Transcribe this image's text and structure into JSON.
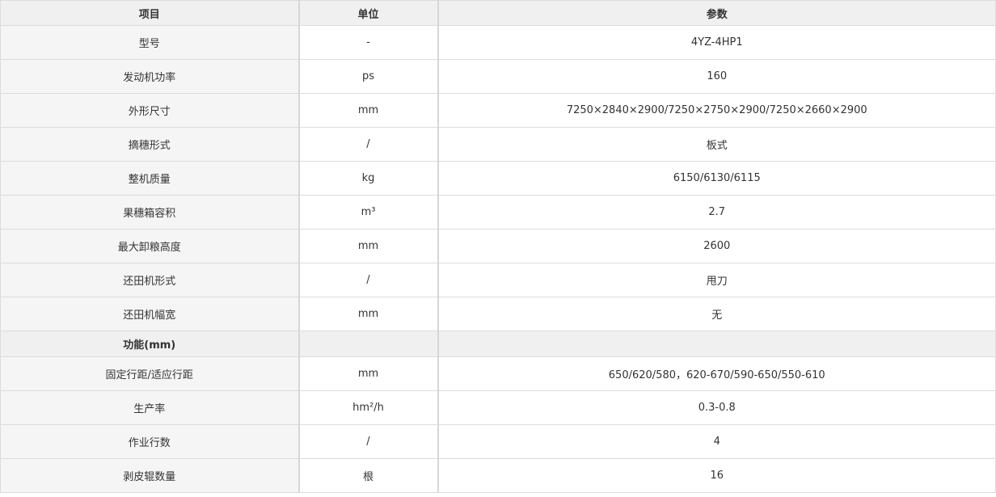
{
  "table": {
    "headers": [
      "项目",
      "单位",
      "参数"
    ],
    "rows": [
      {
        "item": "型号",
        "unit": "-",
        "value": "4YZ-4HP1"
      },
      {
        "item": "发动机功率",
        "unit": "ps",
        "value": "160"
      },
      {
        "item": "外形尺寸",
        "unit": "mm",
        "value": "7250×2840×2900/7250×2750×2900/7250×2660×2900"
      },
      {
        "item": "摘穗形式",
        "unit": "/",
        "value": "板式"
      },
      {
        "item": "整机质量",
        "unit": "kg",
        "value": "6150/6130/6115"
      },
      {
        "item": "果穗箱容积",
        "unit": "m³",
        "value": "2.7"
      },
      {
        "item": "最大卸粮高度",
        "unit": "mm",
        "value": "2600"
      },
      {
        "item": "还田机形式",
        "unit": "/",
        "value": "甩刀"
      },
      {
        "item": "还田机幅宽",
        "unit": "mm",
        "value": "无"
      }
    ],
    "section": {
      "title": "功能(mm)"
    },
    "rows2": [
      {
        "item": "固定行距/适应行距",
        "unit": "mm",
        "value": "650/620/580，620-670/590-650/550-610"
      },
      {
        "item": "生产率",
        "unit": "hm²/h",
        "value": "0.3-0.8"
      },
      {
        "item": "作业行数",
        "unit": "/",
        "value": "4"
      },
      {
        "item": "剥皮辊数量",
        "unit": "根",
        "value": "16"
      }
    ]
  }
}
